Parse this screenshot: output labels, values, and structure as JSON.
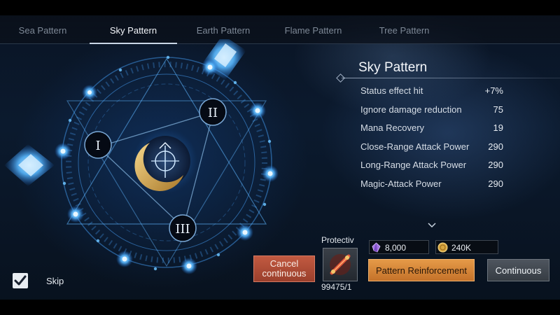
{
  "tabs": [
    {
      "label": "Sea Pattern",
      "active": false
    },
    {
      "label": "Sky Pattern",
      "active": true
    },
    {
      "label": "Earth Pattern",
      "active": false
    },
    {
      "label": "Flame Pattern",
      "active": false
    },
    {
      "label": "Tree Pattern",
      "active": false
    }
  ],
  "sigil": {
    "nodes": [
      "I",
      "II",
      "III"
    ]
  },
  "stats": {
    "title": "Sky Pattern",
    "rows": [
      {
        "name": "Status effect hit",
        "value": "+7%"
      },
      {
        "name": "Ignore damage reduction",
        "value": "75"
      },
      {
        "name": "Mana Recovery",
        "value": "19"
      },
      {
        "name": "Close-Range Attack Power",
        "value": "290"
      },
      {
        "name": "Long-Range Attack Power",
        "value": "290"
      },
      {
        "name": "Magic-Attack Power",
        "value": "290"
      }
    ]
  },
  "currencies": [
    {
      "icon": "purple-crystal-icon",
      "value": "8,000"
    },
    {
      "icon": "gold-coin-icon",
      "value": "240K"
    }
  ],
  "protection": {
    "label": "Protectiv",
    "count": "99475/1",
    "icon": "protection-scroll-icon"
  },
  "buttons": {
    "cancel": "Cancel continuous",
    "reinforce": "Pattern Reinforcement",
    "continuous": "Continuous"
  },
  "skip": {
    "label": "Skip",
    "checked": true
  },
  "colors": {
    "accent_orange": "#d9893a",
    "cancel_red": "#b04c36",
    "glow_blue": "#4fb4ff"
  }
}
